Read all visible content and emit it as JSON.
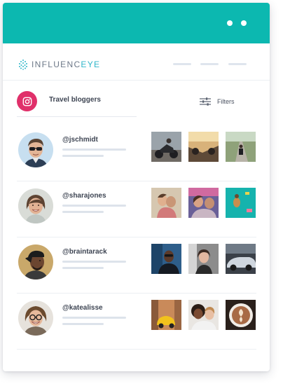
{
  "window": {
    "accent_color": "#0cb8b0"
  },
  "brand": {
    "name_part1": "INFLUENC",
    "name_part2": "EYE",
    "logo_icon": "dotted-eye-logo-icon"
  },
  "list_header": {
    "platform_icon": "instagram-icon",
    "title": "Travel bloggers",
    "filters_label": "Filters",
    "filters_icon": "sliders-icon"
  },
  "influencers": [
    {
      "handle": "@jschmidt",
      "avatar": "man-with-sunglasses"
    },
    {
      "handle": "@sharajones",
      "avatar": "smiling-woman"
    },
    {
      "handle": "@braintarack",
      "avatar": "man-with-cap"
    },
    {
      "handle": "@katealisse",
      "avatar": "woman-with-glasses"
    }
  ]
}
